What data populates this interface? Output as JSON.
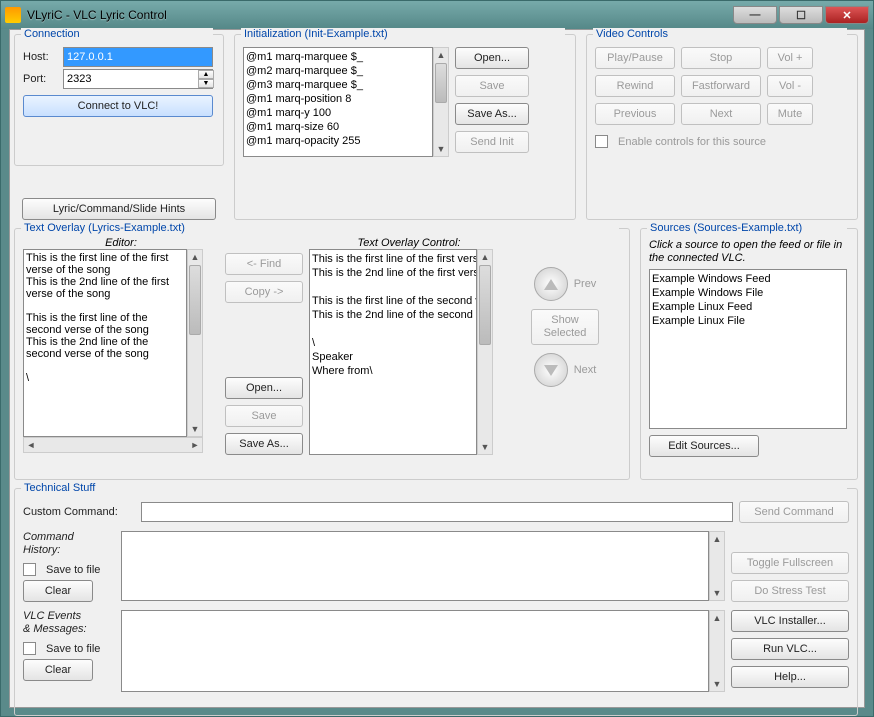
{
  "window": {
    "title": "VLyriC - VLC Lyric Control"
  },
  "connection": {
    "legend": "Connection",
    "host_label": "Host:",
    "host_value": "127.0.0.1",
    "port_label": "Port:",
    "port_value": "2323",
    "connect_label": "Connect to VLC!"
  },
  "hints_button": "Lyric/Command/Slide Hints",
  "init": {
    "legend": "Initialization (Init-Example.txt)",
    "lines": "@m1 marq-marquee $_\n@m2 marq-marquee $_\n@m3 marq-marquee $_\n@m1 marq-position 8\n@m1 marq-y 100\n@m1 marq-size 60\n@m1 marq-opacity 255",
    "open": "Open...",
    "save": "Save",
    "saveas": "Save As...",
    "sendinit": "Send Init"
  },
  "video": {
    "legend": "Video Controls",
    "playpause": "Play/Pause",
    "stop": "Stop",
    "volup": "Vol +",
    "rewind": "Rewind",
    "fastforward": "Fastforward",
    "voldown": "Vol -",
    "previous": "Previous",
    "next": "Next",
    "mute": "Mute",
    "enable": "Enable controls for this source"
  },
  "overlay": {
    "legend": "Text Overlay (Lyrics-Example.txt)",
    "editor_label": "Editor:",
    "control_label": "Text Overlay Control:",
    "editor_text": "This is the first line of the first verse of the song\nThis is the 2nd line of the first verse of the song\n\nThis is the first line of the second verse of the song\nThis is the 2nd line of the second verse of the song\n\n\\",
    "control_text": "This is the first line of the first verse of the song\nThis is the 2nd line of the first verse of the song\n\nThis is the first line of the second verse of the song\nThis is the 2nd line of the second verse of the song\n\n\\\nSpeaker\nWhere from\\",
    "find": "<- Find",
    "copy": "Copy ->",
    "open": "Open...",
    "save": "Save",
    "saveas": "Save As...",
    "prev": "Prev",
    "showsel": "Show\nSelected",
    "next": "Next"
  },
  "sources": {
    "legend": "Sources (Sources-Example.txt)",
    "hint": "Click a source to open the feed or file in the connected VLC.",
    "items": "Example Windows Feed\nExample Windows File\nExample Linux Feed\nExample Linux File",
    "edit": "Edit Sources..."
  },
  "tech": {
    "legend": "Technical Stuff",
    "custom_label": "Custom Command:",
    "send": "Send Command",
    "history_label": "Command\nHistory:",
    "save_to_file": "Save to file",
    "clear": "Clear",
    "events_label": "VLC Events\n& Messages:",
    "toggle_fs": "Toggle Fullscreen",
    "stress": "Do Stress Test",
    "installer": "VLC Installer...",
    "runvlc": "Run VLC...",
    "help": "Help..."
  }
}
